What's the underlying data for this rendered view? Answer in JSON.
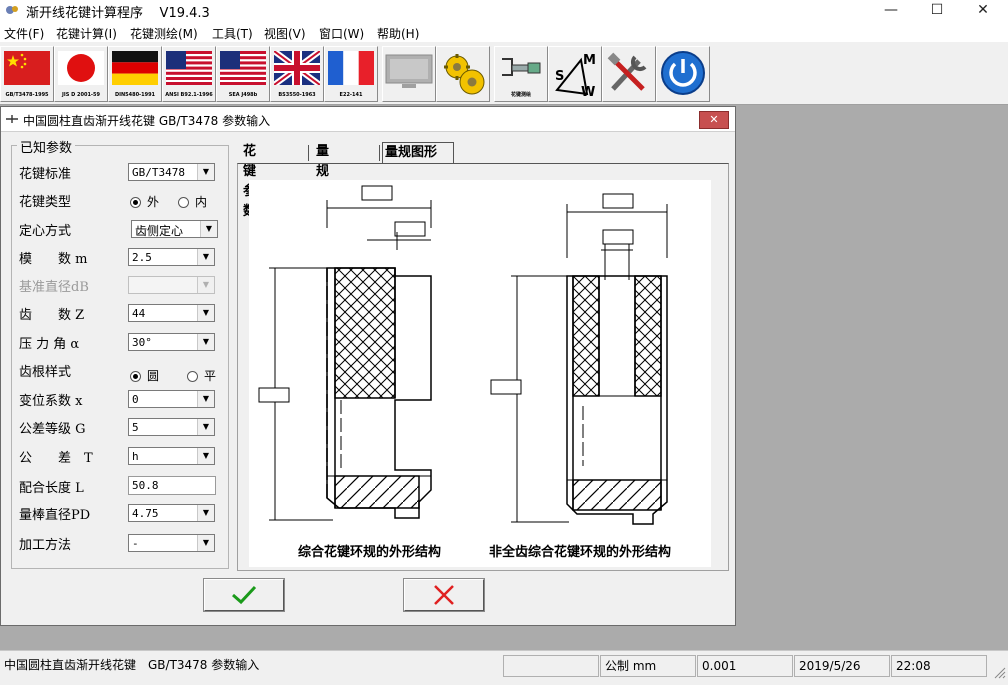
{
  "app": {
    "title": "渐开线花键计算程序",
    "version": "V19.4.3"
  },
  "window_controls": {
    "minimize": "—",
    "maximize": "☐",
    "close": "✕"
  },
  "menu": [
    "文件(F)",
    "花键计算(I)",
    "花键测绘(M)",
    "工具(T)",
    "视图(V)",
    "窗口(W)",
    "帮助(H)"
  ],
  "toolbar": {
    "buttons": [
      {
        "label": "GB/T3478-1995",
        "icon": "china-flag-icon"
      },
      {
        "label": "JIS D 2001-59",
        "icon": "japan-flag-icon"
      },
      {
        "label": "DIN5480-1991",
        "icon": "germany-flag-icon"
      },
      {
        "label": "ANSI B92.1-1996",
        "icon": "usa-flag-icon"
      },
      {
        "label": "SEA J498b",
        "icon": "usa-flag-icon"
      },
      {
        "label": "BS3550-1963",
        "icon": "uk-flag-icon"
      },
      {
        "label": "E22-141",
        "icon": "france-flag-icon"
      },
      {
        "label": "",
        "icon": "monitor-icon"
      },
      {
        "label": "",
        "icon": "gears-icon"
      },
      {
        "label": "花键测绘",
        "icon": "micrometer-icon"
      },
      {
        "label": "",
        "icon": "smw-icon"
      },
      {
        "label": "",
        "icon": "tools-icon"
      },
      {
        "label": "",
        "icon": "power-icon"
      }
    ]
  },
  "dialog": {
    "title": "中国圆柱直齿渐开线花键 GB/T3478 参数输入",
    "close_label": "✕",
    "known_params": {
      "title": "已知参数",
      "rows": [
        {
          "label": "花键标准",
          "value": "GB/T3478"
        },
        {
          "label": "花键类型"
        },
        {
          "label": "定心方式",
          "value": "齿侧定心"
        },
        {
          "label": "模　　数 m",
          "value": "2.5"
        },
        {
          "label": "基准直径dB",
          "value": ""
        },
        {
          "label": "齿　　数 Z",
          "value": "44"
        },
        {
          "label": "压 力 角 α",
          "value": "30°"
        },
        {
          "label": "齿根样式"
        },
        {
          "label": "变位系数 x",
          "value": "0"
        },
        {
          "label": "公差等级 G",
          "value": "5"
        },
        {
          "label": "公　　差　T",
          "value": "h"
        },
        {
          "label": "配合长度 L",
          "value": "50.8"
        },
        {
          "label": "量棒直径PD",
          "value": "4.75"
        },
        {
          "label": "加工方法",
          "value": "-"
        }
      ],
      "spline_type_options": [
        "外",
        "内"
      ],
      "root_style_options": [
        "圆",
        "平"
      ]
    },
    "tabs": [
      "花键参数",
      "量规参数",
      "量规图形"
    ],
    "active_tab": "量规图形",
    "figure_captions": [
      "综合花键环规的外形结构",
      "非全齿综合花键环规的外形结构"
    ],
    "ok_symbol": "✓",
    "cancel_symbol": "✕"
  },
  "status_bar": {
    "message": "中国圆柱直齿渐开线花键　GB/T3478 参数输入",
    "unit": "公制 mm",
    "precision": "0.001",
    "date": "2019/5/26",
    "time": "22:08"
  },
  "colors": {
    "ok_green": "#1a9a1a",
    "cancel_red": "#e02020",
    "close_red": "#c75050"
  }
}
